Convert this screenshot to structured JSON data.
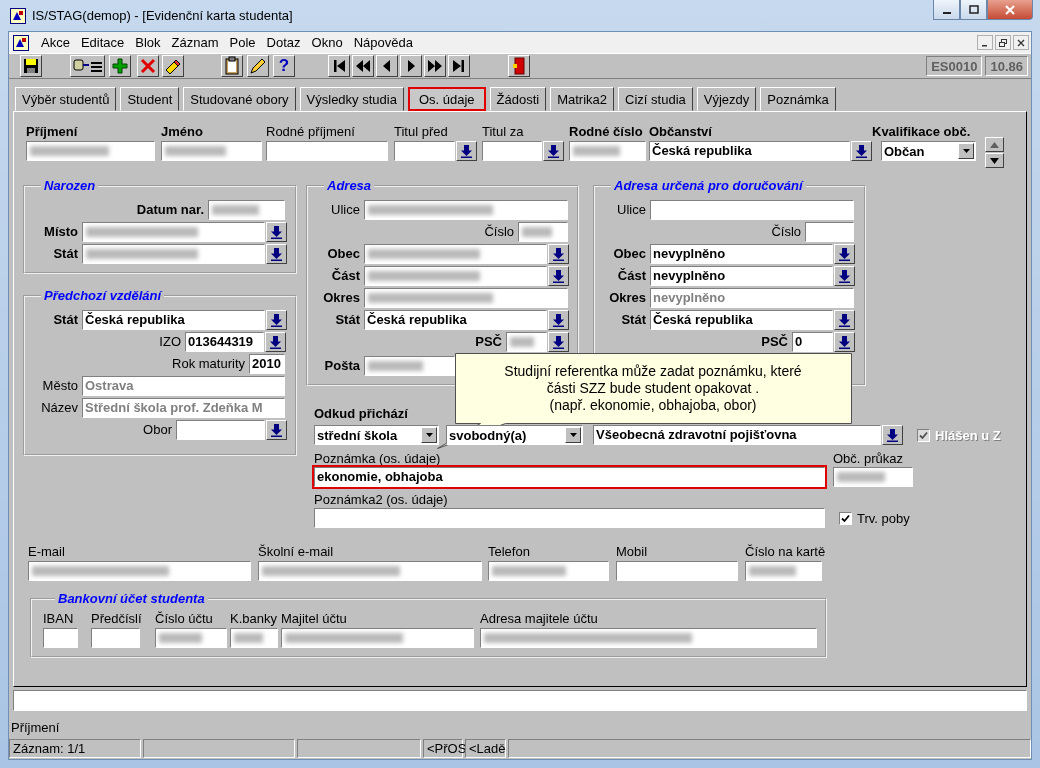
{
  "window": {
    "title": "IS/STAG(demop) - [Evidenční karta studenta]"
  },
  "menu": [
    "Akce",
    "Editace",
    "Blok",
    "Záznam",
    "Pole",
    "Dotaz",
    "Okno",
    "Nápověda"
  ],
  "toolbar": {
    "help": "?",
    "form_code": "ES0010",
    "version": "10.86"
  },
  "tabs": [
    {
      "label": "Výběr studentů",
      "selected": false
    },
    {
      "label": "Student",
      "selected": false
    },
    {
      "label": "Studované obory",
      "selected": false
    },
    {
      "label": "Výsledky studia",
      "selected": false
    },
    {
      "label": "Os. údaje",
      "selected": true
    },
    {
      "label": "Žádosti",
      "selected": false
    },
    {
      "label": "Matrika2",
      "selected": false
    },
    {
      "label": "Cizí studia",
      "selected": false
    },
    {
      "label": "Výjezdy",
      "selected": false
    },
    {
      "label": "Poznámka",
      "selected": false
    }
  ],
  "header": [
    {
      "label": "Příjmení",
      "required": true,
      "kind": "text",
      "redacted": true
    },
    {
      "label": "Jméno",
      "required": true,
      "kind": "text",
      "redacted": true
    },
    {
      "label": "Rodné příjmení",
      "required": false,
      "kind": "text",
      "redacted": false
    },
    {
      "label": "Titul před",
      "required": false,
      "kind": "lov",
      "redacted": false
    },
    {
      "label": "Titul za",
      "required": false,
      "kind": "lov",
      "redacted": false
    },
    {
      "label": "Rodné číslo",
      "required": true,
      "kind": "text",
      "redacted": true
    },
    {
      "label": "Občanství",
      "required": true,
      "kind": "lov",
      "value": "Česká republika",
      "redacted": false
    },
    {
      "label": "Kvalifikace obč.",
      "required": true,
      "kind": "select",
      "value": "Občan"
    }
  ],
  "birth": {
    "title": "Narozen",
    "rows": [
      {
        "label": "Datum nar.",
        "required": true,
        "kind": "text",
        "redacted": true
      },
      {
        "label": "Místo",
        "required": true,
        "kind": "lov",
        "redacted": true
      },
      {
        "label": "Stát",
        "required": true,
        "kind": "lov",
        "redacted": true
      }
    ]
  },
  "previous_education": {
    "title": "Předchozí vzdělání",
    "rows": [
      {
        "label": "Stát",
        "required": true,
        "kind": "lov",
        "value": "Česká republika",
        "redacted": false,
        "disabled": false
      },
      {
        "label": "IZO",
        "required": false,
        "kind": "lov",
        "value": "013644319",
        "redacted": false,
        "disabled": false
      },
      {
        "label": "Rok maturity",
        "required": false,
        "kind": "text",
        "value": "2010",
        "redacted": false,
        "disabled": false
      },
      {
        "label": "Město",
        "required": false,
        "kind": "text",
        "value": "Ostrava",
        "redacted": false,
        "disabled": true
      },
      {
        "label": "Název",
        "required": false,
        "kind": "text",
        "value": "Střední škola prof. Zdeňka M",
        "redacted": false,
        "disabled": true
      },
      {
        "label": "Obor",
        "required": false,
        "kind": "lov",
        "redacted": false
      }
    ]
  },
  "address": {
    "title": "Adresa",
    "rows": [
      {
        "label": "Ulice",
        "required": false,
        "kind": "text",
        "redacted": true,
        "disabled": false
      },
      {
        "label": "Číslo",
        "required": false,
        "kind": "text",
        "redacted": true,
        "disabled": false
      },
      {
        "label": "Obec",
        "required": true,
        "kind": "lov",
        "redacted": true,
        "disabled": false
      },
      {
        "label": "Část",
        "required": true,
        "kind": "lov",
        "redacted": true,
        "disabled": false
      },
      {
        "label": "Okres",
        "required": true,
        "kind": "text",
        "redacted": true,
        "disabled": false
      },
      {
        "label": "Stát",
        "required": true,
        "kind": "lov",
        "value": "Česká republika",
        "redacted": false,
        "disabled": false
      },
      {
        "label": "PSČ",
        "required": true,
        "kind": "lov",
        "redacted": true,
        "disabled": false
      },
      {
        "label": "Pošta",
        "required": true,
        "kind": "text",
        "redacted": true,
        "disabled": false
      }
    ]
  },
  "delivery_address": {
    "title": "Adresa určená pro doručování",
    "rows": [
      {
        "label": "Ulice",
        "required": false,
        "kind": "text",
        "redacted": false
      },
      {
        "label": "Číslo",
        "required": false,
        "kind": "text",
        "redacted": false
      },
      {
        "label": "Obec",
        "required": true,
        "kind": "lov",
        "value": "nevyplněno",
        "redacted": false,
        "disabled": false
      },
      {
        "label": "Část",
        "required": true,
        "kind": "lov",
        "value": "nevyplněno",
        "redacted": false,
        "disabled": false
      },
      {
        "label": "Okres",
        "required": true,
        "kind": "text",
        "value": "nevyplněno",
        "redacted": false,
        "disabled": true
      },
      {
        "label": "Stát",
        "required": true,
        "kind": "lov",
        "value": "Česká republika",
        "redacted": false,
        "disabled": false
      },
      {
        "label": "PSČ",
        "required": true,
        "kind": "lov",
        "value": "0",
        "redacted": false,
        "disabled": false
      }
    ]
  },
  "details": {
    "origin": {
      "label": "Odkud přichází",
      "required": true,
      "kind": "select",
      "value": "střední škola"
    },
    "marital": {
      "kind": "select",
      "value": "svobodný(a)"
    },
    "insurer": {
      "kind": "lov",
      "value": "Všeobecná zdravotní pojišťovna",
      "redacted": false
    },
    "registered": {
      "kind": "checkbox",
      "label": "Hlášen u Z",
      "checked": true,
      "disabled": true
    },
    "note": {
      "label": "Poznámka (os. údaje)",
      "required": false,
      "kind": "text",
      "value": "ekonomie, obhajoba",
      "highlighted": true
    },
    "id_card": {
      "label": "Obč. průkaz",
      "required": false,
      "kind": "text",
      "redacted": true
    },
    "note2": {
      "label": "Poznámka2 (os. údaje)",
      "required": false,
      "kind": "text",
      "highlighted": false
    },
    "permanent": {
      "kind": "checkbox",
      "label": "Trv. poby",
      "checked": true,
      "disabled": false
    }
  },
  "contacts": [
    {
      "label": "E-mail",
      "required": false,
      "kind": "text",
      "redacted": true
    },
    {
      "label": "Školní e-mail",
      "required": false,
      "kind": "text",
      "redacted": true
    },
    {
      "label": "Telefon",
      "required": false,
      "kind": "text",
      "redacted": true
    },
    {
      "label": "Mobil",
      "required": false,
      "kind": "text",
      "redacted": false
    },
    {
      "label": "Číslo na kartě",
      "required": false,
      "kind": "text",
      "redacted": true
    }
  ],
  "bank_account": {
    "title": "Bankovní účet studenta",
    "fields": [
      {
        "label": "IBAN",
        "required": false,
        "kind": "text",
        "redacted": false
      },
      {
        "label": "Předčíslí",
        "required": false,
        "kind": "text",
        "redacted": false
      },
      {
        "label": "Číslo účtu",
        "required": false,
        "kind": "text",
        "redacted": true
      },
      {
        "label": "K.banky",
        "required": false,
        "kind": "text",
        "redacted": true
      },
      {
        "label": "Majitel účtu",
        "required": false,
        "kind": "text",
        "redacted": true
      },
      {
        "label": "Adresa majitele účtu",
        "required": false,
        "kind": "text",
        "redacted": true
      }
    ]
  },
  "callout": {
    "lines": [
      "Studijní referentka může zadat poznámku, které",
      "části SZZ bude student opakovat .",
      "(např. ekonomie, obhajoba, obor)"
    ]
  },
  "hint": "Příjmení",
  "status_bar": {
    "record": "Záznam: 1/1",
    "cell_4": "<PřOS",
    "cell_5": "<Ladě"
  }
}
